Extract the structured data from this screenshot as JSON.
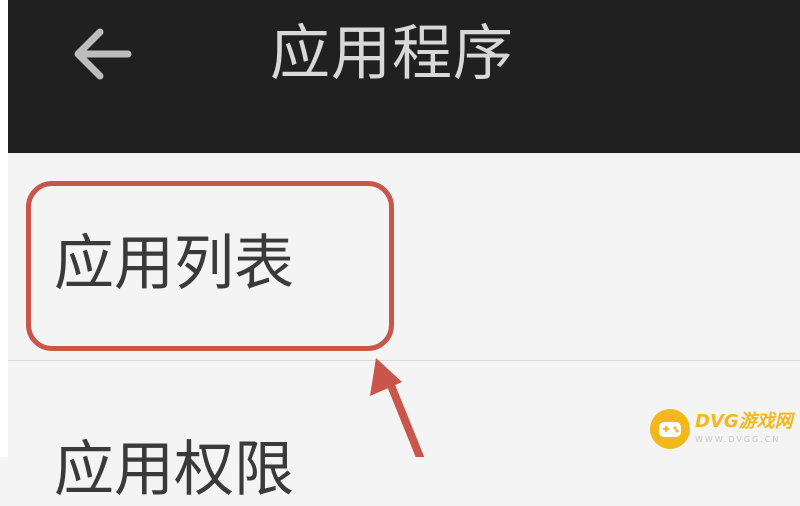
{
  "header": {
    "title": "应用程序",
    "back_icon": "back-arrow-icon"
  },
  "list": {
    "items": [
      {
        "label": "应用列表"
      },
      {
        "label": "应用权限"
      }
    ]
  },
  "annotation": {
    "highlight_color": "#c9554b"
  },
  "watermark": {
    "title": "DVG游戏网",
    "subtitle": "WWW.DVGG.CN",
    "accent": "#f2b81e"
  }
}
